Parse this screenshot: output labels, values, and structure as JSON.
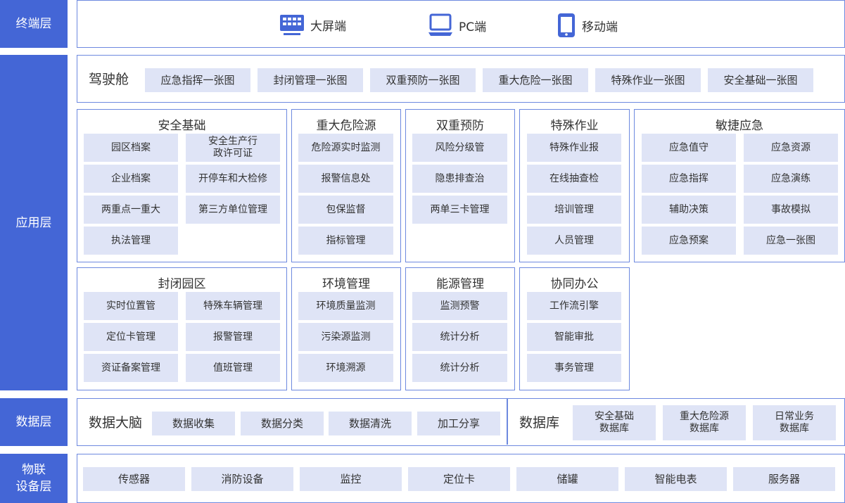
{
  "colors": {
    "layer_bg": "#4466d6",
    "border": "#6d89df",
    "cell_bg": "#dfe4f6",
    "icon": "#4466d6"
  },
  "layers": {
    "terminal": "终端层",
    "application": "应用层",
    "data": "数据层",
    "iot_line1": "物联",
    "iot_line2": "设备层"
  },
  "terminal": {
    "items": [
      {
        "icon": "big-screen-icon",
        "label": "大屏端"
      },
      {
        "icon": "pc-icon",
        "label": "PC端"
      },
      {
        "icon": "mobile-icon",
        "label": "移动端"
      }
    ]
  },
  "cockpit": {
    "title": "驾驶舱",
    "items": [
      "应急指挥一张图",
      "封闭管理一张图",
      "双重预防一张图",
      "重大危险一张图",
      "特殊作业一张图",
      "安全基础一张图"
    ]
  },
  "groups": {
    "safety": {
      "title": "安全基础",
      "cells": [
        "园区档案",
        "安全生产行\n政许可证",
        "企业档案",
        "开停车和大检修",
        "两重点一重大",
        "第三方单位管理",
        "执法管理"
      ]
    },
    "hazard": {
      "title": "重大危险源",
      "cells": [
        "危险源实时监测",
        "报警信息处",
        "包保监督",
        "指标管理"
      ]
    },
    "dual": {
      "title": "双重预防",
      "cells": [
        "风险分级管",
        "隐患排查治",
        "两单三卡管理"
      ]
    },
    "special": {
      "title": "特殊作业",
      "cells": [
        "特殊作业报",
        "在线抽查检",
        "培训管理",
        "人员管理"
      ]
    },
    "emergency": {
      "title": "敏捷应急",
      "cells": [
        "应急值守",
        "应急资源",
        "应急指挥",
        "应急演练",
        "辅助决策",
        "事故模拟",
        "应急预案",
        "应急一张图"
      ]
    },
    "closed": {
      "title": "封闭园区",
      "cells": [
        "实时位置管",
        "特殊车辆管理",
        "定位卡管理",
        "报警管理",
        "资证备案管理",
        "值班管理"
      ]
    },
    "env": {
      "title": "环境管理",
      "cells": [
        "环境质量监测",
        "污染源监测",
        "环境溯源"
      ]
    },
    "energy": {
      "title": "能源管理",
      "cells": [
        "监测预警",
        "统计分析",
        "统计分析"
      ]
    },
    "office": {
      "title": "协同办公",
      "cells": [
        "工作流引擎",
        "智能审批",
        "事务管理"
      ]
    }
  },
  "data_layer": {
    "brain_title": "数据大脑",
    "brain_items": [
      "数据收集",
      "数据分类",
      "数据清洗",
      "加工分享"
    ],
    "db_title": "数据库",
    "db_items": [
      "安全基础\n数据库",
      "重大危险源\n数据库",
      "日常业务\n数据库"
    ]
  },
  "iot": {
    "items": [
      "传感器",
      "消防设备",
      "监控",
      "定位卡",
      "储罐",
      "智能电表",
      "服务器"
    ]
  }
}
